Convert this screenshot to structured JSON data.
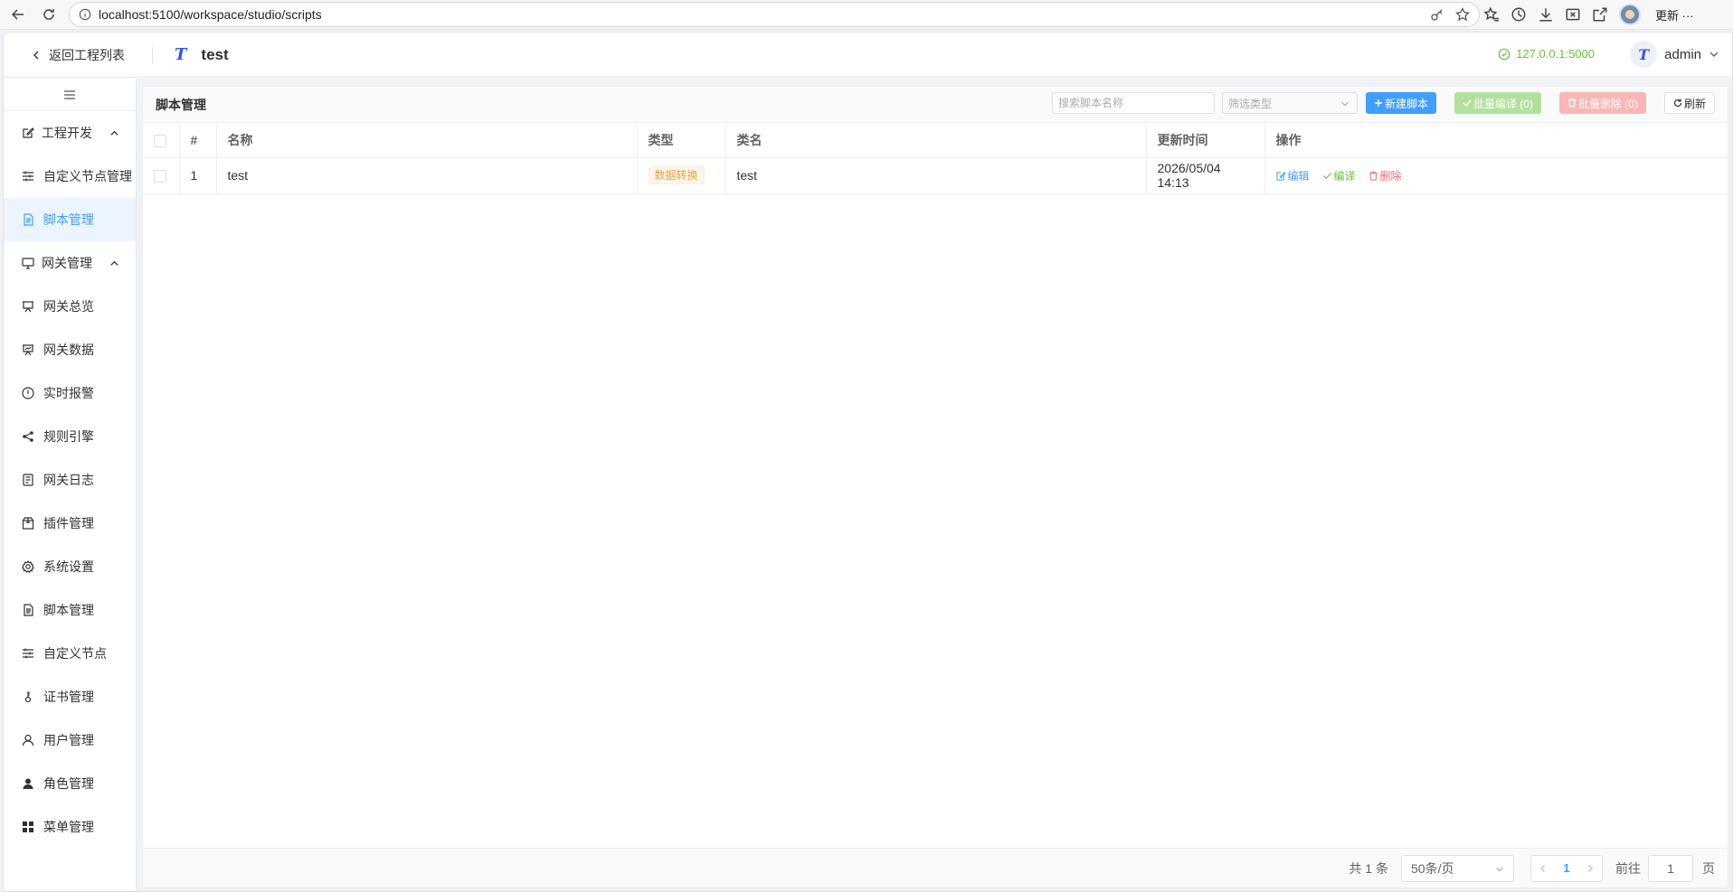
{
  "browser": {
    "url": "localhost:5100/workspace/studio/scripts",
    "update_label": "更新 ···"
  },
  "header": {
    "back_label": "返回工程列表",
    "logo_letter": "T",
    "project_name": "test",
    "server_address": "127.0.0.1:5000",
    "user_avatar_letter": "T",
    "user_name": "admin"
  },
  "sidebar": {
    "groups": [
      {
        "label": "工程开发",
        "icon": "edit-icon",
        "expanded": true
      },
      {
        "label": "网关管理",
        "icon": "monitor-icon",
        "expanded": true
      }
    ],
    "items": [
      {
        "label": "自定义节点管理",
        "icon": "sliders-icon"
      },
      {
        "label": "脚本管理",
        "icon": "document-icon",
        "active": true
      },
      {
        "label": "网关总览",
        "icon": "presentation-icon"
      },
      {
        "label": "网关数据",
        "icon": "data-board-icon"
      },
      {
        "label": "实时报警",
        "icon": "alert-icon"
      },
      {
        "label": "规则引擎",
        "icon": "share-icon"
      },
      {
        "label": "网关日志",
        "icon": "log-icon"
      },
      {
        "label": "插件管理",
        "icon": "box-icon"
      },
      {
        "label": "系统设置",
        "icon": "gear-icon"
      },
      {
        "label": "脚本管理",
        "icon": "document-icon"
      },
      {
        "label": "自定义节点",
        "icon": "sliders-icon"
      },
      {
        "label": "证书管理",
        "icon": "key-icon"
      },
      {
        "label": "用户管理",
        "icon": "user-icon"
      },
      {
        "label": "角色管理",
        "icon": "user-filled-icon"
      },
      {
        "label": "菜单管理",
        "icon": "grid-icon"
      }
    ]
  },
  "main": {
    "title": "脚本管理",
    "search_placeholder": "搜索脚本名称",
    "filter_placeholder": "筛选类型",
    "new_button": "新建脚本",
    "batch_compile_button": "批量编译 (0)",
    "batch_delete_button": "批量删除 (0)",
    "refresh_button": "刷新",
    "columns": [
      "#",
      "名称",
      "类型",
      "类名",
      "更新时间",
      "操作"
    ],
    "rows": [
      {
        "index": "1",
        "name": "test",
        "type": "数据转换",
        "class_name": "test",
        "updated": "2026/05/04 14:13"
      }
    ],
    "actions": {
      "edit": "编辑",
      "compile": "编译",
      "delete": "删除"
    }
  },
  "pager": {
    "total": "共 1 条",
    "page_size": "50条/页",
    "current_page": "1",
    "goto_label": "前往",
    "goto_value": "1",
    "goto_suffix": "页"
  },
  "colors": {
    "primary": "#409eff",
    "success": "#67c23a",
    "danger": "#f56c6c",
    "warning": "#e6a23c",
    "active_menu_bg": "#ecf5ff"
  }
}
